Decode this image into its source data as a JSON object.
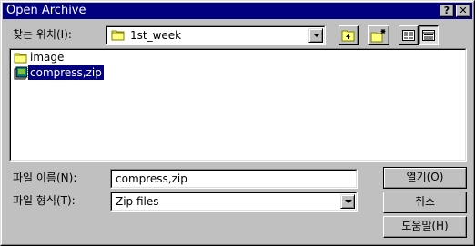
{
  "window": {
    "title": "Open Archive",
    "help_glyph": "?",
    "close_glyph": "✕"
  },
  "lookin": {
    "label": "찾는 위치(I):",
    "value": "1st_week"
  },
  "files": [
    {
      "name": "image",
      "type": "folder",
      "selected": false
    },
    {
      "name": "compress,zip",
      "type": "archive",
      "selected": true
    }
  ],
  "filename": {
    "label": "파일 이름(N):",
    "value": "compress,zip"
  },
  "filetype": {
    "label": "파일 형식(T):",
    "value": "Zip files"
  },
  "buttons": {
    "open": "열기(O)",
    "cancel": "취소",
    "help": "도움말(H)"
  },
  "colors": {
    "titlebar": "#000080",
    "face": "#c0c0c0",
    "selection": "#000080"
  }
}
